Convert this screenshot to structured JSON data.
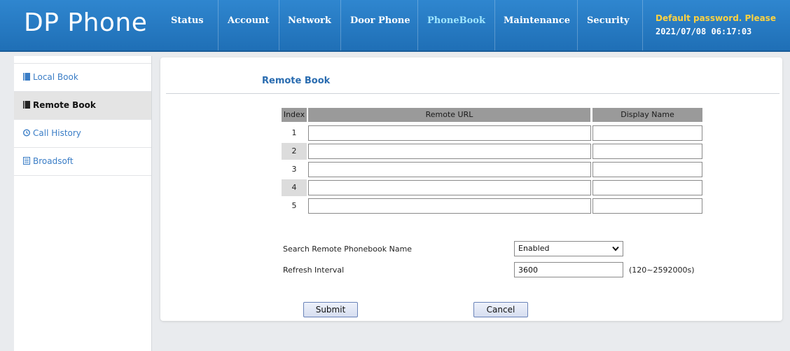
{
  "header": {
    "brand": "DP Phone",
    "nav": [
      "Status",
      "Account",
      "Network",
      "Door Phone",
      "PhoneBook",
      "Maintenance",
      "Security"
    ],
    "active_nav": "PhoneBook",
    "notice": "Default password. Please",
    "datetime": "2021/07/08 06:17:03",
    "colors": {
      "bar": "#1f6fb6",
      "active_nav": "#9fe6ff",
      "notice": "#ffd23f"
    }
  },
  "sidebar": {
    "items": [
      {
        "label": "Local Book",
        "icon": "book-icon"
      },
      {
        "label": "Remote Book",
        "icon": "book-icon"
      },
      {
        "label": "Call History",
        "icon": "clock-icon"
      },
      {
        "label": "Broadsoft",
        "icon": "list-icon"
      }
    ],
    "active": "Remote Book"
  },
  "main": {
    "title": "Remote Book",
    "table": {
      "headers": {
        "index": "Index",
        "url": "Remote URL",
        "name": "Display Name"
      },
      "rows": [
        {
          "index": "1",
          "url": "",
          "name": ""
        },
        {
          "index": "2",
          "url": "",
          "name": ""
        },
        {
          "index": "3",
          "url": "",
          "name": ""
        },
        {
          "index": "4",
          "url": "",
          "name": ""
        },
        {
          "index": "5",
          "url": "",
          "name": ""
        }
      ]
    },
    "search_label": "Search Remote Phonebook Name",
    "search_value": "Enabled",
    "refresh_label": "Refresh Interval",
    "refresh_value": "3600",
    "refresh_hint": "(120~2592000s)",
    "submit": "Submit",
    "cancel": "Cancel"
  }
}
